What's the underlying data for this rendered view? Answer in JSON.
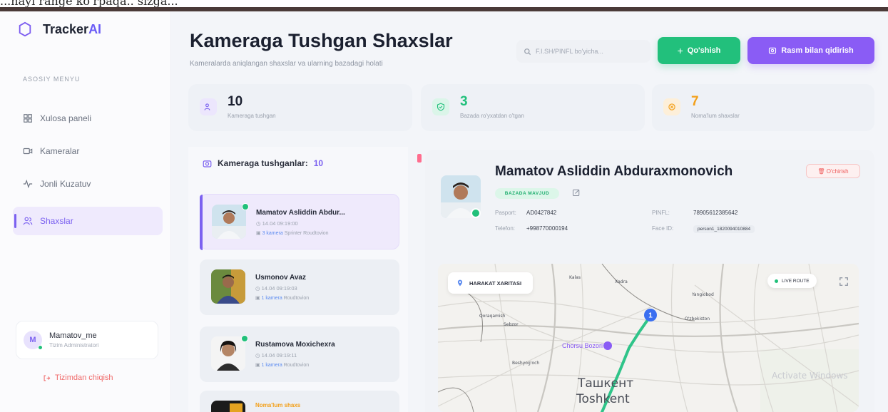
{
  "header_strip": {
    "text": "...nayi range ko'rpaqa.. sizga..."
  },
  "app": {
    "name_main": "Tracker",
    "name_accent": "AI"
  },
  "sidebar": {
    "section_label": "ASOSIY MENYU",
    "items": [
      {
        "label": "Xulosa paneli",
        "icon": "grid-icon"
      },
      {
        "label": "Kameralar",
        "icon": "camera-icon"
      },
      {
        "label": "Jonli Kuzatuv",
        "icon": "pulse-icon"
      },
      {
        "label": "Shaxslar",
        "icon": "users-icon",
        "active": true
      }
    ],
    "user": {
      "initial": "M",
      "name": "Mamatov_me",
      "role": "Tizim Administratori"
    },
    "logout": "Tizimdan chiqish"
  },
  "page": {
    "title": "Kameraga Tushgan Shaxslar",
    "subtitle": "Kameralarda aniqlangan shaxslar va ularning bazadagi holati",
    "search_placeholder": "F.I.SH/PINFL bo'yicha...",
    "add_button": "Qo'shish",
    "photo_search_button": "Rasm bilan qidirish"
  },
  "stats": [
    {
      "value": "10",
      "label": "Kameraga tushgan",
      "color": "#7b61f0"
    },
    {
      "value": "3",
      "label": "Bazada ro'yxatdan o'tgan",
      "color": "#22c07c"
    },
    {
      "value": "7",
      "label": "Noma'lum shaxslar",
      "color": "#f3a01a"
    }
  ],
  "list": {
    "title": "Kameraga tushganlar:",
    "count": "10",
    "items": [
      {
        "name": "Mamatov Asliddin Abdur...",
        "date": "14.04 09:19:00",
        "camera_count": "3 kamera",
        "camera": "Sprinter Roudtovion"
      },
      {
        "name": "Usmonov Avaz",
        "date": "14.04 09:19:03",
        "camera_count": "1 kamera",
        "camera": "Roudtovion"
      },
      {
        "name": "Rustamova Moxichexra",
        "date": "14.04 09:19:11",
        "camera_count": "1 kamera",
        "camera": "Roudtovion"
      },
      {
        "name": "Noma'lum shaxs"
      }
    ]
  },
  "detail": {
    "name": "Mamatov Asliddin Abduraxmonovich",
    "delete": "O'chirish",
    "tag": "BAZADA MAVJUD",
    "fields": {
      "passport_label": "Pasport:",
      "passport": "AD0427842",
      "phone_label": "Telefon:",
      "phone": "+998770000194",
      "pinfl_label": "PINFL:",
      "pinfl": "78905612385642",
      "face_label": "Face ID:",
      "face": "person1_1820094010884"
    }
  },
  "map": {
    "chip": "HARAKAT XARITASI",
    "live": "LIVE ROUTE",
    "city_ru": "Ташкент",
    "city_uz": "Toshkent",
    "poi": "Chorsu Bozori",
    "watermark": "Activate Windows",
    "marker": "1",
    "labels": [
      "Qoraqamish",
      "Sebzor",
      "Beshyog'och",
      "Kalas",
      "Xadra",
      "O'zbekiston",
      "Yangiobod"
    ],
    "route_color": "#2fc489"
  }
}
